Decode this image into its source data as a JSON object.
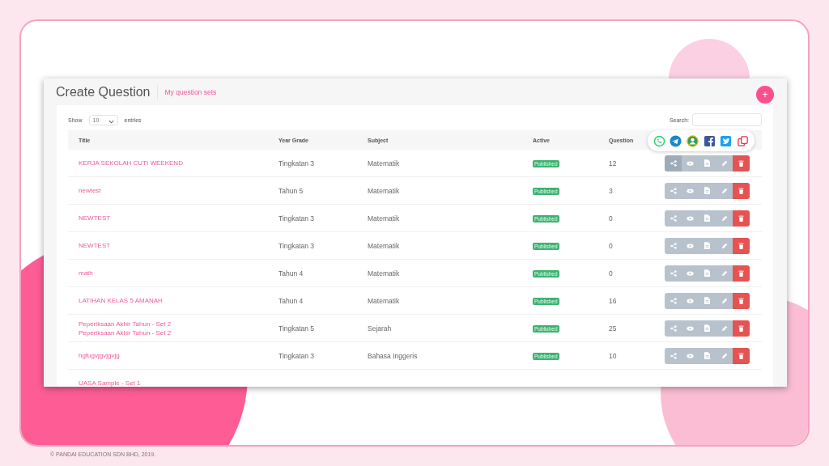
{
  "page": {
    "title": "Create Question",
    "link": "My question sets",
    "add_button": "+"
  },
  "controls": {
    "show_label": "Show",
    "page_size": "10",
    "entries_label": "entries",
    "search_label": "Search:"
  },
  "table": {
    "columns": [
      "Title",
      "Year Grade",
      "Subject",
      "Active",
      "Question"
    ],
    "rows": [
      {
        "title": [
          "KERJA SEKOLAH CUTI WEEKEND"
        ],
        "grade": "Tingkatan 3",
        "subject": "Matematik",
        "status": "Published",
        "questions": "12"
      },
      {
        "title": [
          "newtest"
        ],
        "grade": "Tahun 5",
        "subject": "Matematik",
        "status": "Published",
        "questions": "3"
      },
      {
        "title": [
          "NEWTEST"
        ],
        "grade": "Tingkatan 3",
        "subject": "Matematik",
        "status": "Published",
        "questions": "0"
      },
      {
        "title": [
          "NEWTEST"
        ],
        "grade": "Tingkatan 3",
        "subject": "Matematik",
        "status": "Published",
        "questions": "0"
      },
      {
        "title": [
          "math"
        ],
        "grade": "Tahun 4",
        "subject": "Matematik",
        "status": "Published",
        "questions": "0"
      },
      {
        "title": [
          "LATIHAN KELAS 5 AMANAH"
        ],
        "grade": "Tahun 4",
        "subject": "Matematik",
        "status": "Published",
        "questions": "16"
      },
      {
        "title": [
          "Peperiksaan Akhir Tahun - Set 2",
          "Peperiksaan Akhir Tahun - Set 2"
        ],
        "grade": "Tingkatan 5",
        "subject": "Sejarah",
        "status": "Published",
        "questions": "25"
      },
      {
        "title": [
          "hgfugvjgvjgvjg"
        ],
        "grade": "Tingkatan 3",
        "subject": "Bahasa Inggeris",
        "status": "Published",
        "questions": "10"
      },
      {
        "title": [
          "UASA Sample - Set 1"
        ]
      }
    ]
  },
  "footer": "© PANDAI EDUCATION SDN BHD, 2019."
}
